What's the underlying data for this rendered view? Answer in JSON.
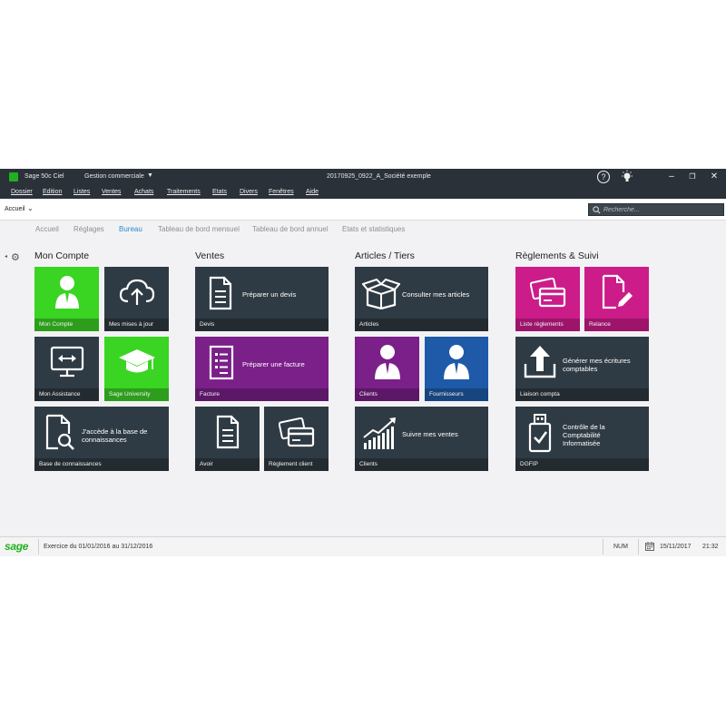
{
  "titlebar": {
    "app_name": "Sage 50c Ciel",
    "module": "Gestion commerciale",
    "document": "20170925_0922_A_Société exemple"
  },
  "menu": [
    "Dossier",
    "Edition",
    "Listes",
    "Ventes",
    "Achats",
    "Traitements",
    "Etats",
    "Divers",
    "Fenêtres",
    "Aide"
  ],
  "address": {
    "value": "Accueil"
  },
  "search": {
    "placeholder": "Recherche..."
  },
  "tabs": [
    "Accueil",
    "Réglages",
    "Bureau",
    "Tableau de bord mensuel",
    "Tableau de bord annuel",
    "Etats et statistiques"
  ],
  "active_tab": "Bureau",
  "sections": {
    "compte": {
      "title": "Mon Compte",
      "tiles": {
        "mon_compte": "Mon Compte",
        "mises_a_jour": "Mes mises à jour",
        "assistance": "Mon Assistance",
        "university": "Sage University",
        "base_label": "Base de connaissances",
        "base_text_1": "J'accède à la base de",
        "base_text_2": "connaissances"
      }
    },
    "ventes": {
      "title": "Ventes",
      "tiles": {
        "devis_label": "Devis",
        "devis_text": "Préparer un devis",
        "facture_label": "Facture",
        "facture_text": "Préparer une facture",
        "avoir": "Avoir",
        "reglement": "Règlement client"
      }
    },
    "articles": {
      "title": "Articles / Tiers",
      "tiles": {
        "articles_label": "Articles",
        "articles_text": "Consulter mes articles",
        "clients": "Clients",
        "fournisseurs": "Fournisseurs",
        "ventes_label": "Clients",
        "ventes_text": "Suivre mes ventes"
      }
    },
    "reglements": {
      "title": "Règlements & Suivi",
      "tiles": {
        "liste": "Liste règlements",
        "relance": "Relance",
        "liaison_label": "Liaison compta",
        "liaison_text_1": "Générer mes écritures",
        "liaison_text_2": "comptables",
        "dgfip_label": "DGFIP",
        "dgfip_text_1": "Contrôle de la",
        "dgfip_text_2": "Comptabilité",
        "dgfip_text_3": "Informatisée"
      }
    }
  },
  "status": {
    "logo": "sage",
    "exercice": "Exercice du 01/01/2016 au 31/12/2016",
    "num": "NUM",
    "date": "15/11/2017",
    "time": "21:32"
  },
  "colors": {
    "green": "#3ad422",
    "purple": "#7a2088",
    "blue": "#1e5aa8",
    "pink": "#cc1c89",
    "dark_tile": "#2f3b44",
    "active_tab": "#2a8bd0"
  }
}
